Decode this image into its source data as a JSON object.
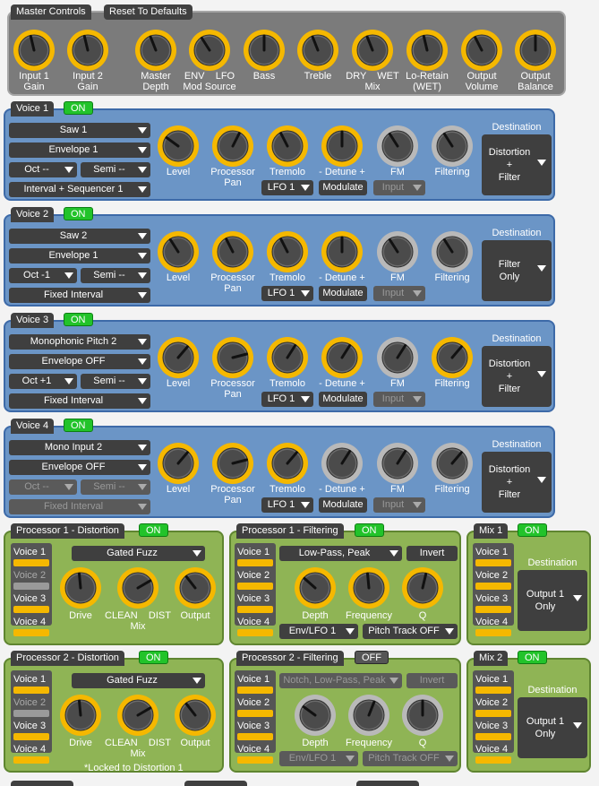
{
  "master": {
    "tab_label": "Master Controls",
    "reset_label": "Reset To Defaults",
    "knobs": [
      {
        "label": "Input 1\nGain",
        "level": 0.45
      },
      {
        "label": "Input 2\nGain",
        "level": 0.45
      },
      {
        "label": "Master\nDepth",
        "level": 0.42
      },
      {
        "label": "ENV    LFO\nMod Source",
        "level": 0.38
      },
      {
        "label": "Bass",
        "level": 0.5
      },
      {
        "label": "Treble",
        "level": 0.42
      },
      {
        "label": "DRY    WET\nMix",
        "level": 0.42
      },
      {
        "label": "Lo-Retain\n(WET)",
        "level": 0.45
      },
      {
        "label": "Output\nVolume",
        "level": 0.4
      },
      {
        "label": "Output\nBalance",
        "level": 0.5
      }
    ]
  },
  "voices": [
    {
      "tab_label": "Voice 1",
      "status": "ON",
      "source": "Saw 1",
      "envelope": "Envelope 1",
      "oct": "Oct --",
      "semi": "Semi --",
      "interval": "Interval + Sequencer 1",
      "oct_disabled": false,
      "knobs": [
        {
          "label": "Level",
          "level": 0.3,
          "active": true
        },
        {
          "label": "Processor\nPan",
          "level": 0.6,
          "active": true
        },
        {
          "label": "Tremolo",
          "level": 0.4,
          "active": true
        },
        {
          "label": "- Detune +",
          "level": 0.5,
          "active": true
        },
        {
          "label": "FM",
          "level": 0.38,
          "active": false
        },
        {
          "label": "Filtering",
          "level": 0.38,
          "active": false
        }
      ],
      "lfo": "LFO 1",
      "modulate": "Modulate",
      "input": "Input",
      "destination_label": "Destination",
      "destination": "Distortion\n+\nFilter"
    },
    {
      "tab_label": "Voice 2",
      "status": "ON",
      "source": "Saw 2",
      "envelope": "Envelope 1",
      "oct": "Oct -1",
      "semi": "Semi --",
      "interval": "Fixed Interval",
      "oct_disabled": false,
      "knobs": [
        {
          "label": "Level",
          "level": 0.38,
          "active": true
        },
        {
          "label": "Processor\nPan",
          "level": 0.4,
          "active": true
        },
        {
          "label": "Tremolo",
          "level": 0.4,
          "active": true
        },
        {
          "label": "- Detune +",
          "level": 0.5,
          "active": true
        },
        {
          "label": "FM",
          "level": 0.38,
          "active": false
        },
        {
          "label": "Filtering",
          "level": 0.38,
          "active": false
        }
      ],
      "lfo": "LFO 1",
      "modulate": "Modulate",
      "input": "Input",
      "destination_label": "Destination",
      "destination": "Filter\nOnly"
    },
    {
      "tab_label": "Voice 3",
      "status": "ON",
      "source": "Monophonic Pitch 2",
      "envelope": "Envelope OFF",
      "oct": "Oct +1",
      "semi": "Semi --",
      "interval": "Fixed Interval",
      "oct_disabled": false,
      "knobs": [
        {
          "label": "Level",
          "level": 0.65,
          "active": true
        },
        {
          "label": "Processor\nPan",
          "level": 0.78,
          "active": true
        },
        {
          "label": "Tremolo",
          "level": 0.62,
          "active": true
        },
        {
          "label": "- Detune +",
          "level": 0.62,
          "active": true
        },
        {
          "label": "FM",
          "level": 0.62,
          "active": false
        },
        {
          "label": "Filtering",
          "level": 0.65,
          "active": true
        }
      ],
      "lfo": "LFO 1",
      "modulate": "Modulate",
      "input": "Input",
      "destination_label": "Destination",
      "destination": "Distortion\n+\nFilter"
    },
    {
      "tab_label": "Voice 4",
      "status": "ON",
      "source": "Mono Input 2",
      "envelope": "Envelope OFF",
      "oct": "Oct --",
      "semi": "Semi --",
      "interval": "Fixed Interval",
      "oct_disabled": true,
      "knobs": [
        {
          "label": "Level",
          "level": 0.65,
          "active": true
        },
        {
          "label": "Processor\nPan",
          "level": 0.78,
          "active": true
        },
        {
          "label": "Tremolo",
          "level": 0.65,
          "active": true
        },
        {
          "label": "- Detune +",
          "level": 0.62,
          "active": false
        },
        {
          "label": "FM",
          "level": 0.62,
          "active": false
        },
        {
          "label": "Filtering",
          "level": 0.65,
          "active": false
        }
      ],
      "lfo": "LFO 1",
      "modulate": "Modulate",
      "input": "Input",
      "destination_label": "Destination",
      "destination": "Distortion\n+\nFilter"
    }
  ],
  "processors": [
    {
      "dist_tab": "Processor 1 - Distortion",
      "dist_status": "ON",
      "dist_voices": [
        {
          "label": "Voice 1",
          "enabled": true
        },
        {
          "label": "Voice 2",
          "enabled": false
        },
        {
          "label": "Voice 3",
          "enabled": true
        },
        {
          "label": "Voice 4",
          "enabled": true
        }
      ],
      "dist_type": "Gated Fuzz",
      "dist_knobs": [
        {
          "label": "Drive",
          "level": 0.48,
          "active": true
        },
        {
          "label": "CLEAN    DIST\nMix",
          "level": 0.72,
          "active": true
        },
        {
          "label": "Output",
          "level": 0.36,
          "active": true
        }
      ],
      "dist_note": "",
      "filt_tab": "Processor 1 - Filtering",
      "filt_status": "ON",
      "filt_voices": [
        {
          "label": "Voice 1",
          "enabled": true
        },
        {
          "label": "Voice 2",
          "enabled": true
        },
        {
          "label": "Voice 3",
          "enabled": true
        },
        {
          "label": "Voice 4",
          "enabled": true
        }
      ],
      "filt_type": "Low-Pass, Peak",
      "filt_invert": "Invert",
      "filt_knobs": [
        {
          "label": "Depth",
          "level": 0.32,
          "active": true
        },
        {
          "label": "Frequency",
          "level": 0.48,
          "active": true
        },
        {
          "label": "Q",
          "level": 0.55,
          "active": true
        }
      ],
      "filt_env": "Env/LFO 1",
      "filt_pitch": "Pitch Track OFF",
      "filt_disabled": false,
      "mix_tab": "Mix 1",
      "mix_status": "ON",
      "mix_voices": [
        {
          "label": "Voice 1",
          "enabled": true
        },
        {
          "label": "Voice 2",
          "enabled": true
        },
        {
          "label": "Voice 3",
          "enabled": true
        },
        {
          "label": "Voice 4",
          "enabled": true
        }
      ],
      "mix_dest_label": "Destination",
      "mix_dest": "Output 1\nOnly"
    },
    {
      "dist_tab": "Processor 2 - Distortion",
      "dist_status": "ON",
      "dist_voices": [
        {
          "label": "Voice 1",
          "enabled": true
        },
        {
          "label": "Voice 2",
          "enabled": false
        },
        {
          "label": "Voice 3",
          "enabled": true
        },
        {
          "label": "Voice 4",
          "enabled": true
        }
      ],
      "dist_type": "Gated Fuzz",
      "dist_knobs": [
        {
          "label": "Drive",
          "level": 0.48,
          "active": true
        },
        {
          "label": "CLEAN    DIST\nMix",
          "level": 0.72,
          "active": true
        },
        {
          "label": "Output",
          "level": 0.36,
          "active": true
        }
      ],
      "dist_note": "*Locked to Distortion 1",
      "filt_tab": "Processor 2 - Filtering",
      "filt_status": "OFF",
      "filt_voices": [
        {
          "label": "Voice 1",
          "enabled": true
        },
        {
          "label": "Voice 2",
          "enabled": true
        },
        {
          "label": "Voice 3",
          "enabled": true
        },
        {
          "label": "Voice 4",
          "enabled": true
        }
      ],
      "filt_type": "Notch, Low-Pass, Peak",
      "filt_invert": "Invert",
      "filt_knobs": [
        {
          "label": "Depth",
          "level": 0.3,
          "active": false
        },
        {
          "label": "Frequency",
          "level": 0.58,
          "active": false
        },
        {
          "label": "Q",
          "level": 0.5,
          "active": false
        }
      ],
      "filt_env": "Env/LFO 1",
      "filt_pitch": "Pitch Track OFF",
      "filt_disabled": true,
      "mix_tab": "Mix 2",
      "mix_status": "ON",
      "mix_voices": [
        {
          "label": "Voice 1",
          "enabled": true
        },
        {
          "label": "Voice 2",
          "enabled": true
        },
        {
          "label": "Voice 3",
          "enabled": true
        },
        {
          "label": "Voice 4",
          "enabled": true
        }
      ],
      "mix_dest_label": "Destination",
      "mix_dest": "Output 1\nOnly"
    }
  ],
  "colors": {
    "knob_active": "#f5b800",
    "knob_inactive": "#b9b9b9",
    "knob_body": "#5a5a5a",
    "on": "#22c32a"
  }
}
